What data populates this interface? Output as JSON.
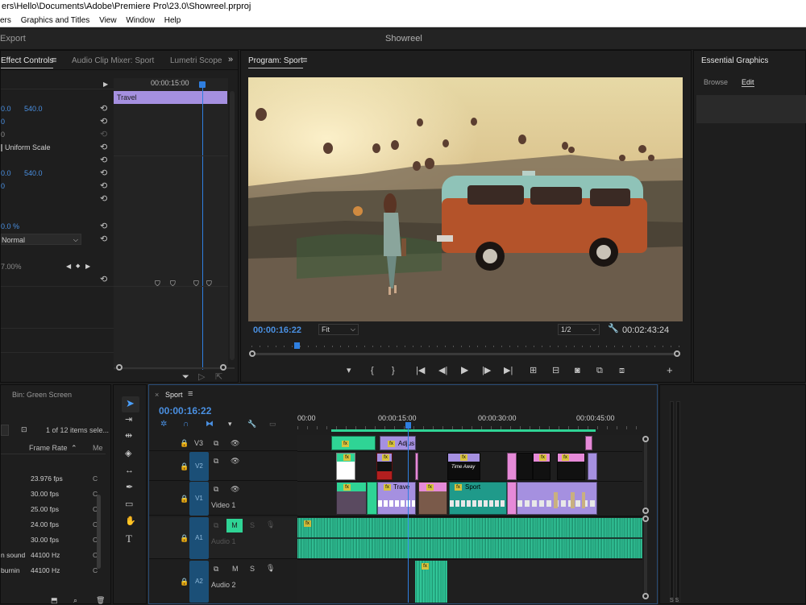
{
  "window": {
    "title": "ers\\Hello\\Documents\\Adobe\\Premiere Pro\\23.0\\Showreel.prproj"
  },
  "menubar": {
    "items": [
      "ers",
      "Graphics and Titles",
      "View",
      "Window",
      "Help"
    ]
  },
  "header": {
    "left_label": "Export",
    "project_title": "Showreel"
  },
  "effect_controls": {
    "tabs": [
      "Effect Controls",
      "Audio Clip Mixer: Sport",
      "Lumetri Scope"
    ],
    "timecode": "00:00:15:00",
    "clip_bar_label": "Travel",
    "rows": [
      {
        "v1": "0.0",
        "v2": "540.0"
      },
      {
        "v1": "0",
        "v2": ""
      },
      {
        "v1": "0",
        "v2": ""
      },
      {
        "v1": "Uniform Scale",
        "v2": ""
      },
      {
        "v1": "",
        "v2": ""
      },
      {
        "v1": "0.0",
        "v2": "540.0"
      },
      {
        "v1": "0",
        "v2": ""
      },
      {
        "v1": "0.0 %",
        "v2": ""
      },
      {
        "v1": "Normal",
        "v2": ""
      },
      {
        "v1": "7.00%",
        "v2": ""
      }
    ]
  },
  "program_monitor": {
    "title": "Program: Sport",
    "current_timecode": "00:00:16:22",
    "zoom": "Fit",
    "resolution": "1/2",
    "duration": "00:02:43:24",
    "playhead_fraction": 0.1
  },
  "essential_graphics": {
    "title": "Essential Graphics",
    "tabs": [
      "Browse",
      "Edit"
    ]
  },
  "project_panel": {
    "bin_title": "Bin: Green Screen",
    "items_count": "1 of 12 items sele...",
    "columns": [
      "Frame Rate",
      "Me"
    ],
    "rows": [
      {
        "name": "",
        "value": "23.976 fps"
      },
      {
        "name": "",
        "value": "30.00 fps"
      },
      {
        "name": "",
        "value": "25.00 fps"
      },
      {
        "name": "",
        "value": "24.00 fps"
      },
      {
        "name": "",
        "value": "30.00 fps"
      },
      {
        "name": "n sound",
        "value": "44100 Hz"
      },
      {
        "name": "burnin",
        "value": "44100 Hz"
      }
    ],
    "meta_col": [
      "C",
      "C",
      "C",
      "C",
      "C",
      "C",
      "C"
    ]
  },
  "timeline": {
    "sequence_name": "Sport",
    "timecode": "00:00:16:22",
    "ruler": [
      "00:00",
      "00:00:15:00",
      "00:00:30:00",
      "00:00:45:00"
    ],
    "tracks": [
      {
        "id": "V3",
        "name": ""
      },
      {
        "id": "V2",
        "name": ""
      },
      {
        "id": "V1",
        "name": "Video 1"
      },
      {
        "id": "A1",
        "name": "Audio 1"
      },
      {
        "id": "A2",
        "name": "Audio 2"
      }
    ],
    "clip_labels": {
      "adjust": "Adjus",
      "travel": "Trave",
      "sport": "Sport",
      "title": "Time Away"
    },
    "track_buttons": {
      "mute": "M",
      "solo": "S"
    }
  },
  "meter": {
    "label": "S S"
  },
  "colors": {
    "accent_blue": "#2f7fe0",
    "clip_purple": "#a590e0",
    "clip_green": "#2fd495",
    "clip_teal": "#1f9a8a",
    "clip_pink": "#e68ad8",
    "waveform": "#2fc79a"
  }
}
